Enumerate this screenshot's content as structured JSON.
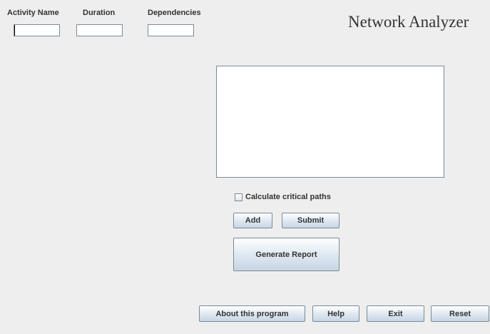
{
  "form": {
    "activity_name_label": "Activity Name",
    "duration_label": "Duration",
    "dependencies_label": "Dependencies",
    "activity_name_value": "",
    "duration_value": "",
    "dependencies_value": ""
  },
  "header": {
    "title": "Network Analyzer"
  },
  "options": {
    "critical_paths_label": "Calculate critical paths",
    "critical_paths_checked": false
  },
  "actions": {
    "add_label": "Add",
    "submit_label": "Submit",
    "generate_report_label": "Generate Report"
  },
  "footer": {
    "about_label": "About this program",
    "help_label": "Help",
    "exit_label": "Exit",
    "reset_label": "Reset"
  },
  "theme": {
    "background": "#eeeeee",
    "border": "#7a8a99",
    "button_gradient_top": "#ffffff",
    "button_gradient_bottom": "#c6d5e4"
  }
}
